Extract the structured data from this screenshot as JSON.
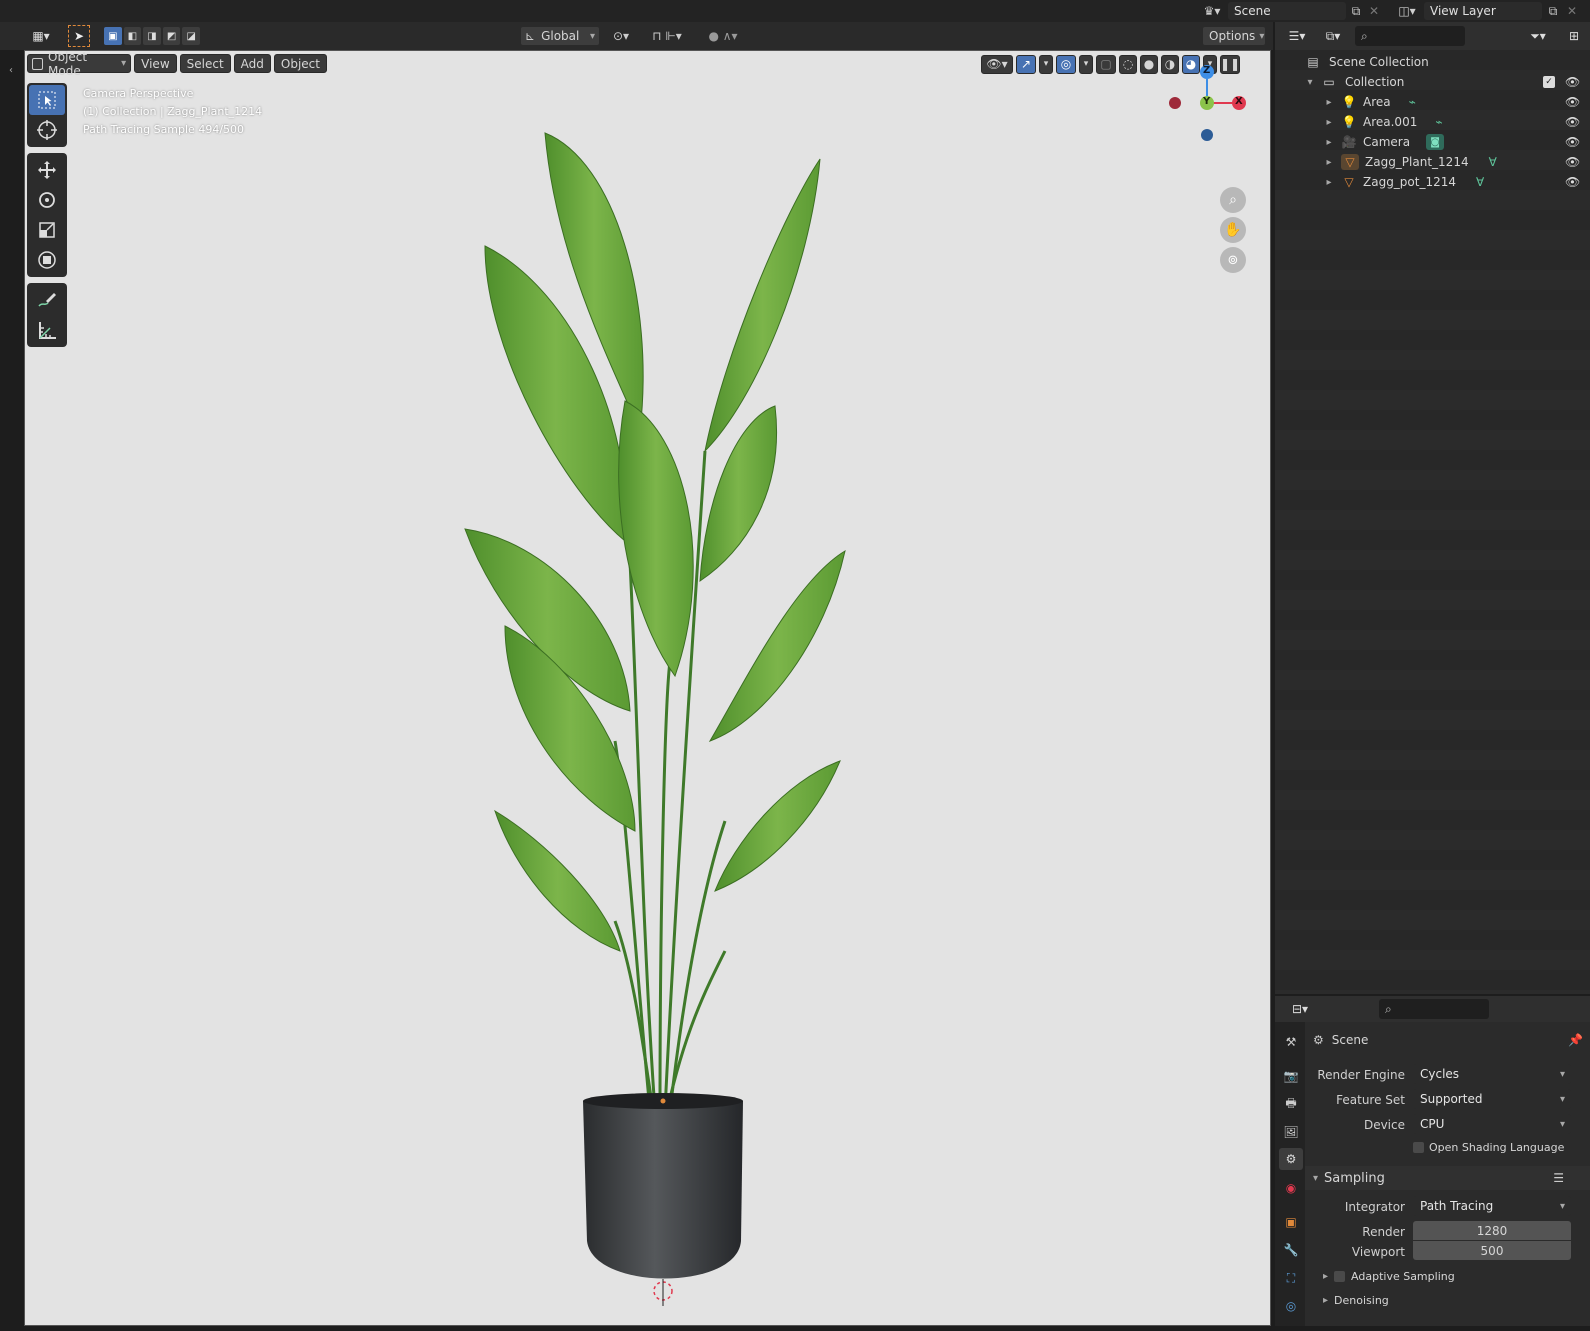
{
  "topbar": {
    "scene_label": "Scene",
    "view_layer_label": "View Layer"
  },
  "viewport_header": {
    "orientation": "Global",
    "options_label": "Options",
    "mode_label": "Object Mode",
    "menus": [
      "View",
      "Select",
      "Add",
      "Object"
    ]
  },
  "viewport_overlay": {
    "line1": "Camera Perspective",
    "line2": "(1) Collection | Zagg_Plant_1214",
    "line3": "Path Tracing Sample 494/500"
  },
  "gizmo": {
    "z": "Z",
    "y": "Y",
    "x": "X"
  },
  "outliner": {
    "scene_collection": "Scene Collection",
    "collection": "Collection",
    "items": [
      {
        "name": "Area",
        "type": "light"
      },
      {
        "name": "Area.001",
        "type": "light"
      },
      {
        "name": "Camera",
        "type": "camera"
      },
      {
        "name": "Zagg_Plant_1214",
        "type": "mesh"
      },
      {
        "name": "Zagg_pot_1214",
        "type": "mesh"
      }
    ]
  },
  "properties": {
    "context_title": "Scene",
    "render_engine_label": "Render Engine",
    "render_engine": "Cycles",
    "feature_set_label": "Feature Set",
    "feature_set": "Supported",
    "device_label": "Device",
    "device": "CPU",
    "osl_label": "Open Shading Language",
    "sampling_label": "Sampling",
    "integrator_label": "Integrator",
    "integrator": "Path Tracing",
    "render_label": "Render",
    "render_samples": "1280",
    "viewport_label": "Viewport",
    "viewport_samples": "500",
    "adaptive_label": "Adaptive Sampling",
    "denoising_label": "Denoising"
  },
  "colors": {
    "accent_blue": "#4772b3",
    "gizmo_x": "#e0394f",
    "gizmo_y": "#8bc34a",
    "gizmo_z": "#3d8ee6",
    "mesh_orange": "#e0893a",
    "data_green": "#5fc59b"
  }
}
